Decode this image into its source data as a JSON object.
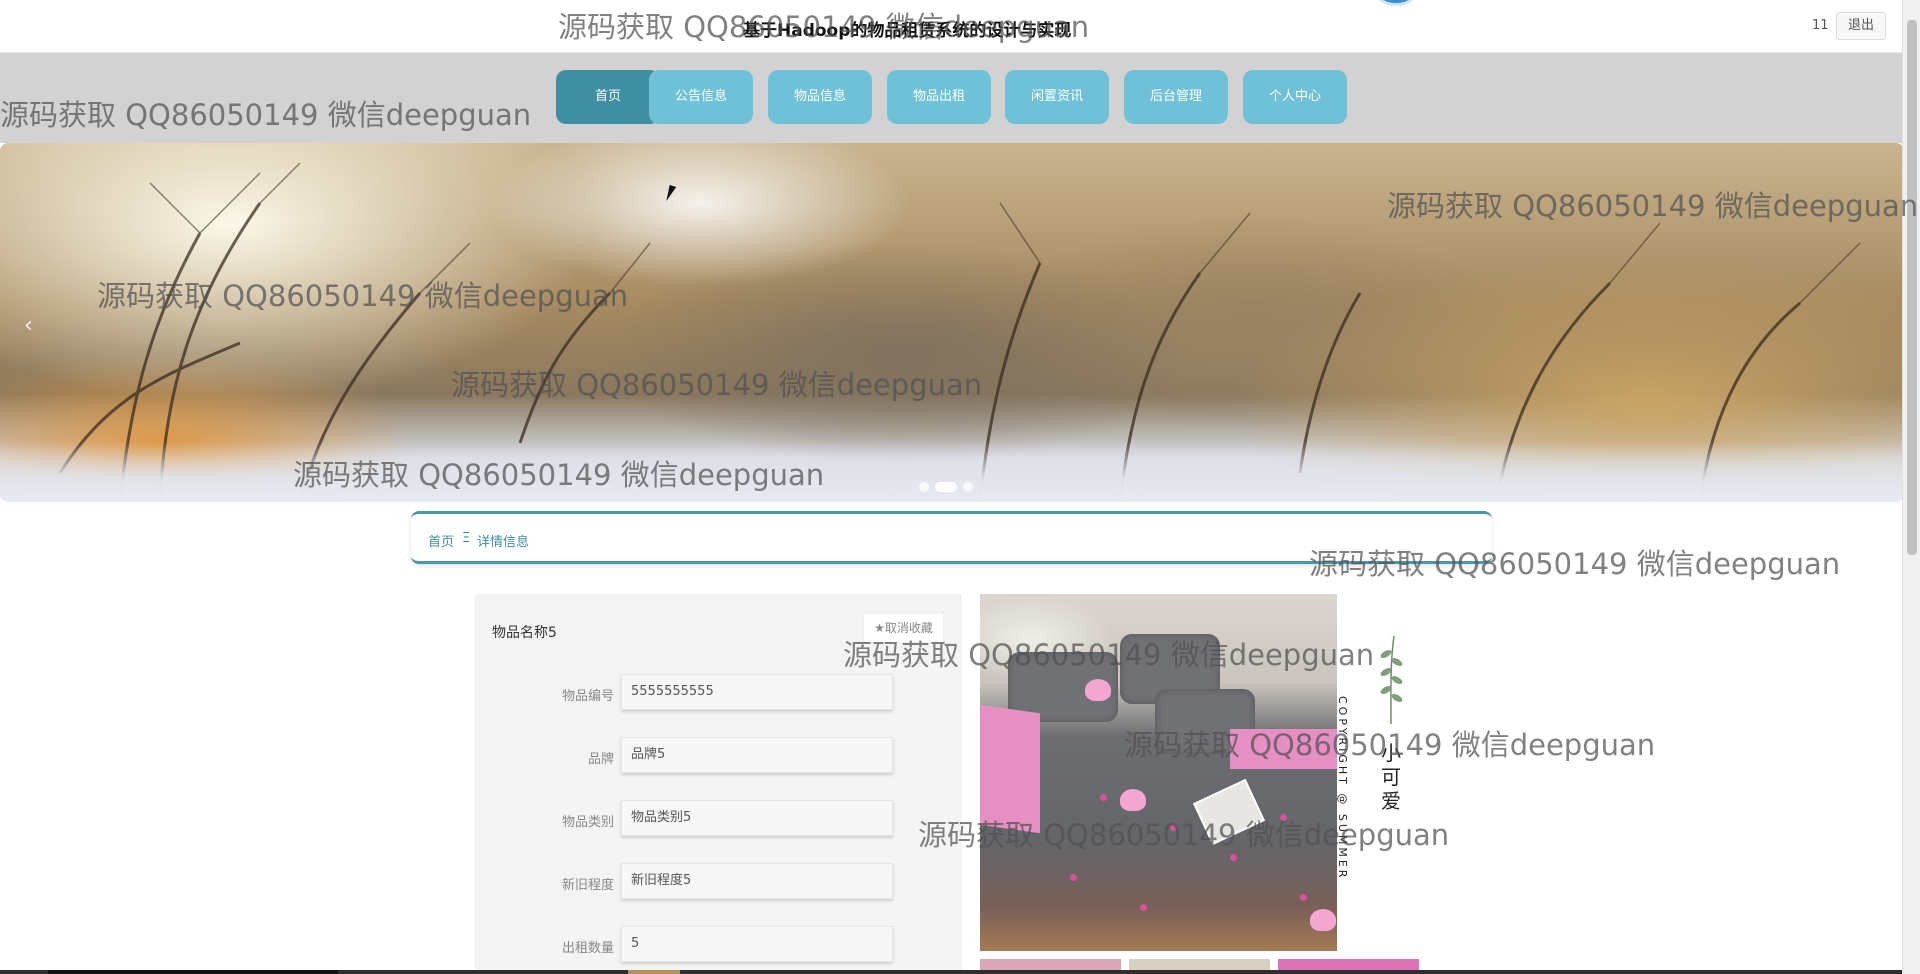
{
  "header": {
    "site_title": "基于Hadoop的物品租赁系统的设计与实现",
    "user_name": "11",
    "logout_label": "退出"
  },
  "nav": {
    "items": [
      {
        "label": "首页",
        "active": true
      },
      {
        "label": "公告信息",
        "active": false
      },
      {
        "label": "物品信息",
        "active": false
      },
      {
        "label": "物品出租",
        "active": false
      },
      {
        "label": "闲置资讯",
        "active": false
      },
      {
        "label": "后台管理",
        "active": false
      },
      {
        "label": "个人中心",
        "active": false
      }
    ]
  },
  "banner": {
    "slide_count": 3,
    "active_slide": 2,
    "prev_arrow": "‹"
  },
  "breadcrumb": {
    "home": "首页",
    "separator": "Ξ",
    "current": "详情信息"
  },
  "detail": {
    "item_name": "物品名称5",
    "favorite_label": "★取消收藏",
    "fields": [
      {
        "label": "物品编号",
        "value": "5555555555"
      },
      {
        "label": "品牌",
        "value": "品牌5"
      },
      {
        "label": "物品类别",
        "value": "物品类别5"
      },
      {
        "label": "新旧程度",
        "value": "新旧程度5"
      },
      {
        "label": "出租数量",
        "value": "5"
      }
    ]
  },
  "product_image": {
    "cute_text": "小可爱",
    "copyright_text": "COPYRIGHT @ SUMMER"
  },
  "watermarks": [
    "源码获取 QQ86050149 微信deepguan",
    "源码获取 QQ86050149 微信deepguan",
    "源码获取 QQ86050149 微信deepguan",
    "源码获取 QQ86050149 微信deepguan",
    "源码获取 QQ86050149 微信deepguan",
    "源码获取 QQ86050149 微信deepguan",
    "源码获取 QQ86050149 微信deepguan",
    "源码获取 QQ86050149 微信deepguan",
    "源码获取 QQ86050149 微信deepguan",
    "源码获取 QQ86050149 微信deepguan"
  ],
  "colors": {
    "nav_button": "#6fc1d8",
    "nav_active": "#3e8fa2",
    "nav_band": "#d2d2d2",
    "breadcrumb_accent": "#4a97a6"
  }
}
